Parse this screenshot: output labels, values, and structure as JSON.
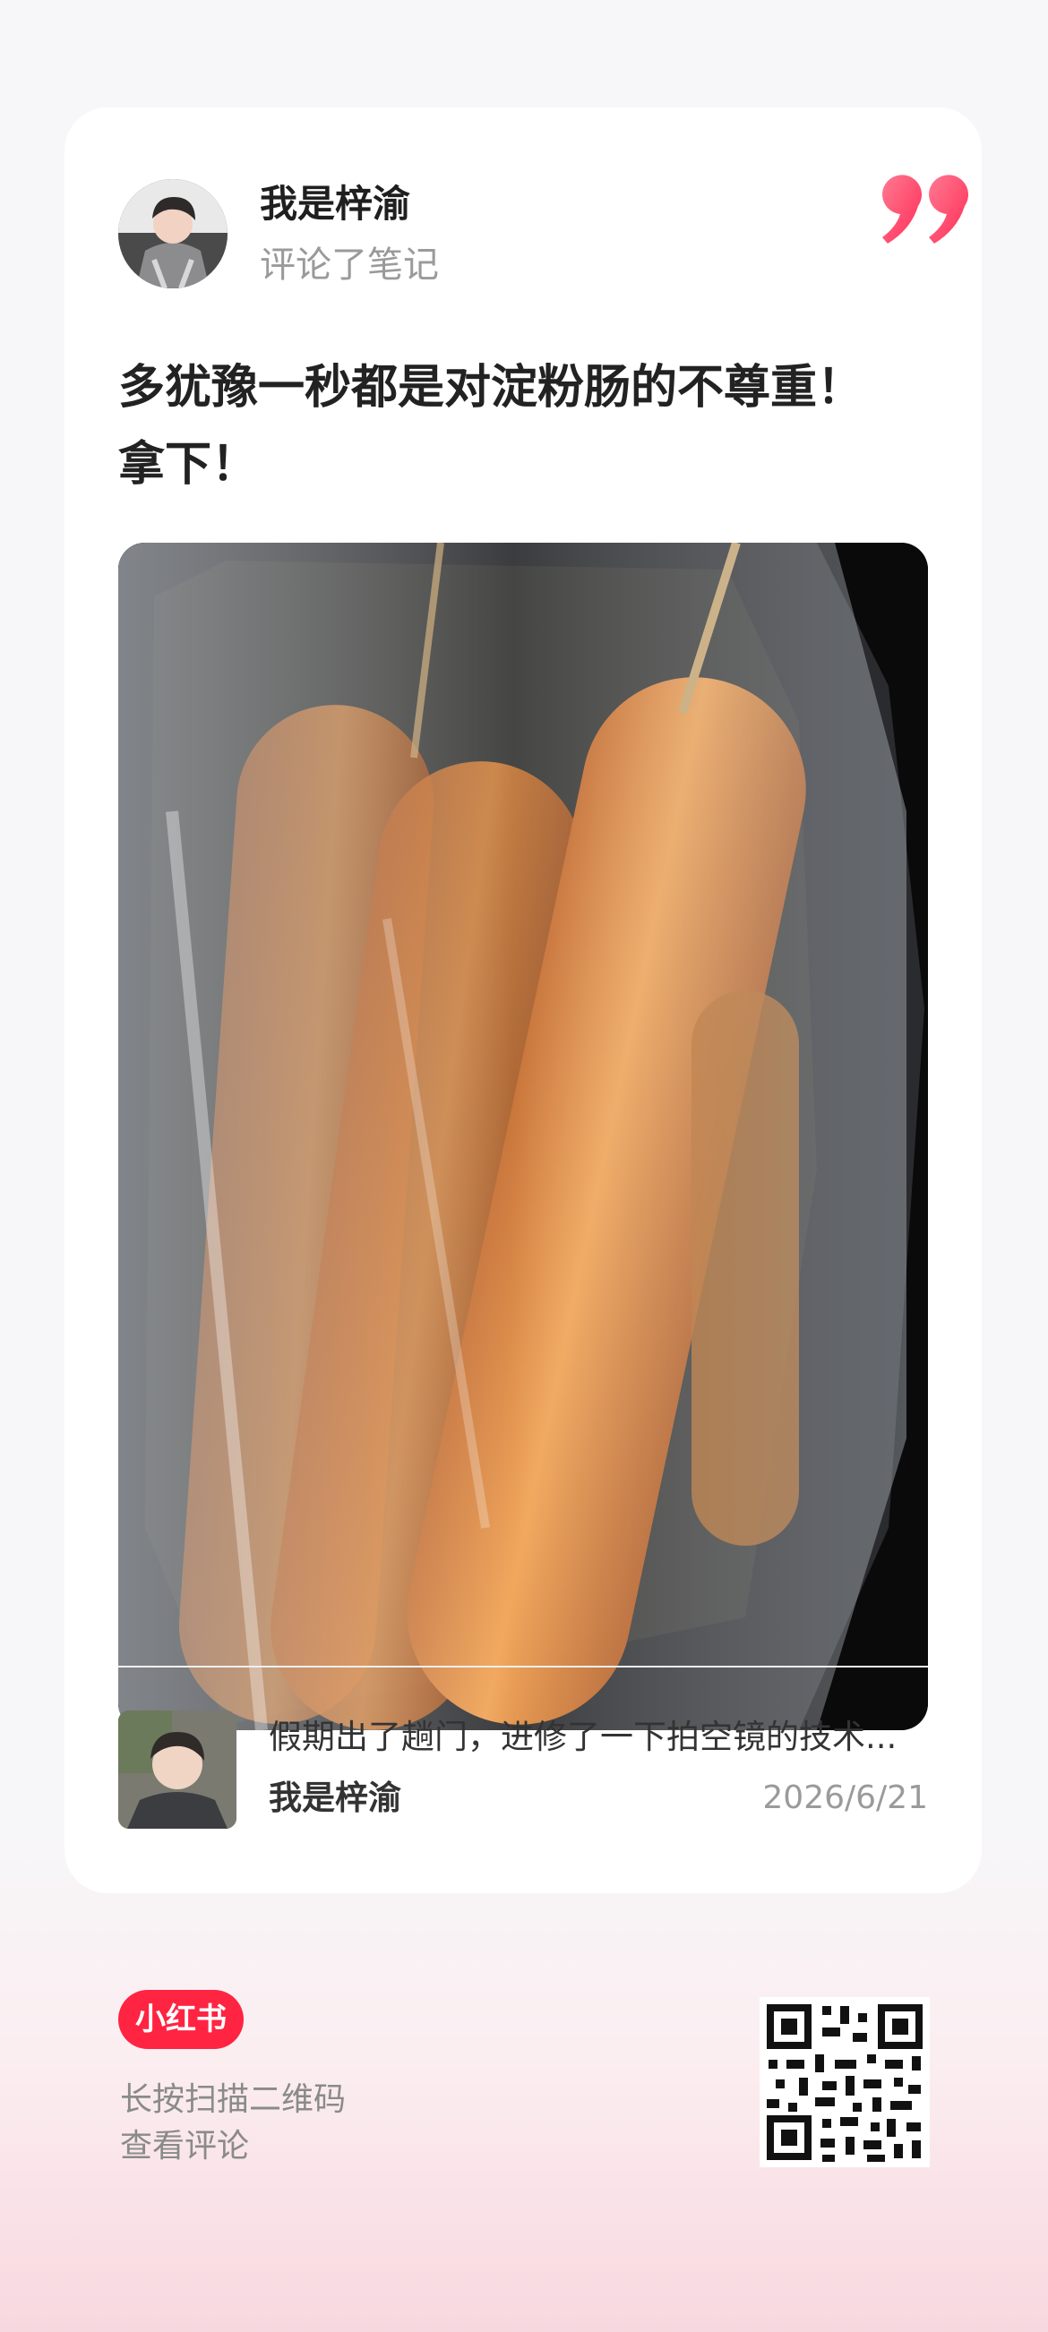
{
  "comment_card": {
    "author_name": "我是梓渝",
    "action_text": "评论了笔记",
    "comment_text": "多犹豫一秒都是对淀粉肠的不尊重！\n拿下！",
    "quote_color": "#ff3b5c"
  },
  "note_preview": {
    "title": "假期出了趟门，进修了一下拍空镜的技术...",
    "author": "我是梓渝",
    "date": "2026/6/21"
  },
  "footer": {
    "brand": "小红书",
    "brand_color": "#ff2442",
    "scan_hint_line1": "长按扫描二维码",
    "scan_hint_line2": "查看评论"
  }
}
